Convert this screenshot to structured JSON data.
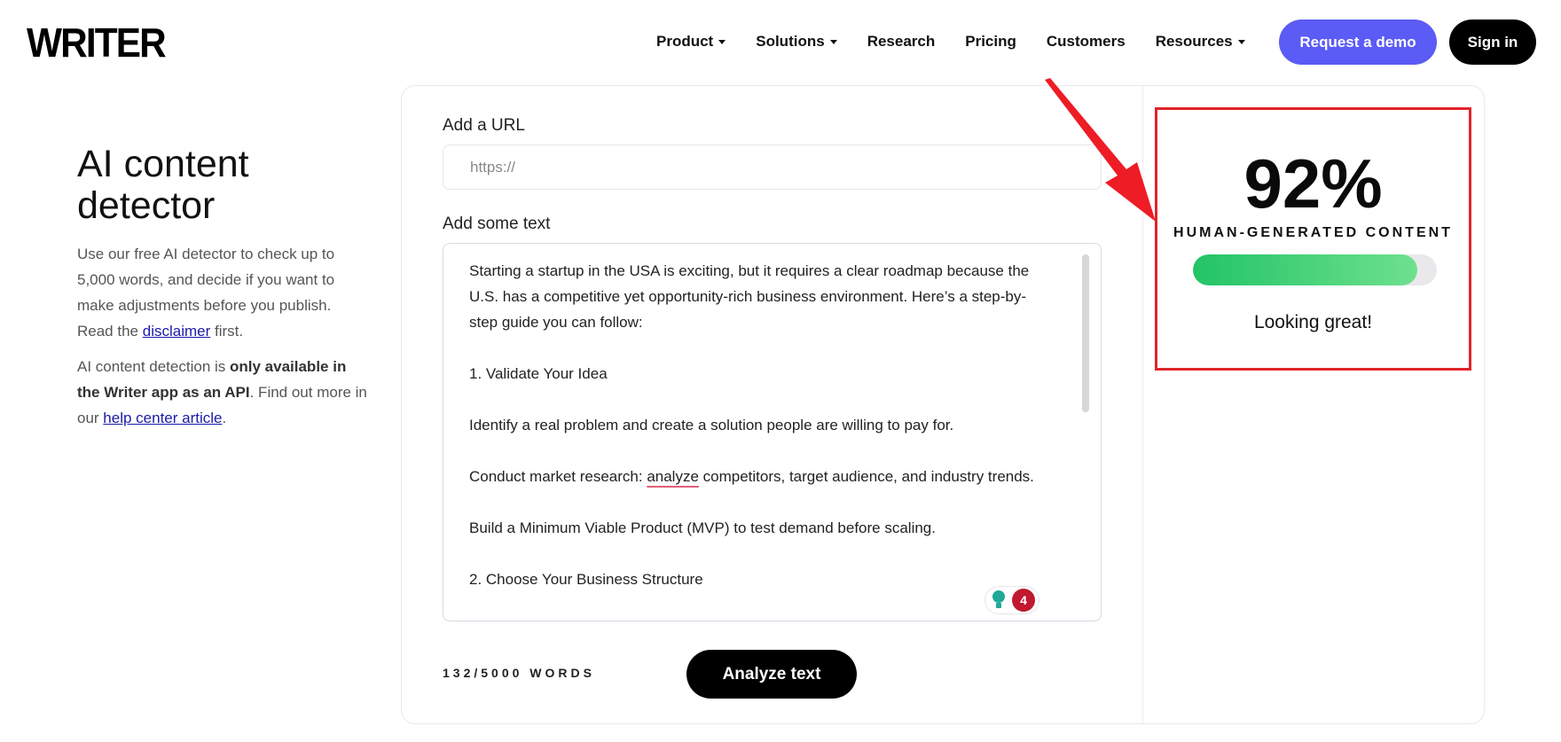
{
  "header": {
    "logo": "WRITER",
    "nav": [
      {
        "label": "Product",
        "dropdown": true
      },
      {
        "label": "Solutions",
        "dropdown": true
      },
      {
        "label": "Research",
        "dropdown": false
      },
      {
        "label": "Pricing",
        "dropdown": false
      },
      {
        "label": "Customers",
        "dropdown": false
      },
      {
        "label": "Resources",
        "dropdown": true
      }
    ],
    "request_demo": "Request a demo",
    "sign_in": "Sign in"
  },
  "left": {
    "title": "AI content detector",
    "desc_1a": "Use our free AI detector to check up to 5,000 words, and decide if you want to make adjustments before you publish. Read the ",
    "desc_1_link": "disclaimer",
    "desc_1b": " first.",
    "desc_2a": "AI content detection is ",
    "desc_2_bold": "only available in the Writer app as an API",
    "desc_2b": ". Find out more in our ",
    "desc_2_link": "help center article",
    "desc_2c": "."
  },
  "form": {
    "url_label": "Add a URL",
    "url_placeholder": "https://",
    "text_label": "Add some text",
    "text_paragraphs": [
      "Starting a startup in the USA is exciting, but it requires a clear roadmap because the U.S. has a competitive yet opportunity-rich business environment. Here’s a step-by-step guide you can follow:",
      "1. Validate Your Idea",
      "Identify a real problem and create a solution people are willing to pay for."
    ],
    "para_market_a": "Conduct market research: ",
    "para_market_flagged": "analyze",
    "para_market_b": " competitors, target audience, and industry trends.",
    "text_paragraphs_2": [
      "Build a Minimum Viable Product (MVP) to test demand before scaling.",
      "2. Choose Your Business Structure"
    ],
    "suggestion_count": "4",
    "word_count": "132/5000 WORDS",
    "analyze_button": "Analyze text"
  },
  "result": {
    "percent": "92%",
    "label": "HUMAN-GENERATED CONTENT",
    "progress_fraction": 0.92,
    "status": "Looking great!"
  },
  "colors": {
    "accent": "#5b5bf5",
    "progress": "#22c466",
    "highlight_box": "#e0252a",
    "flag_badge": "#c0182f"
  }
}
